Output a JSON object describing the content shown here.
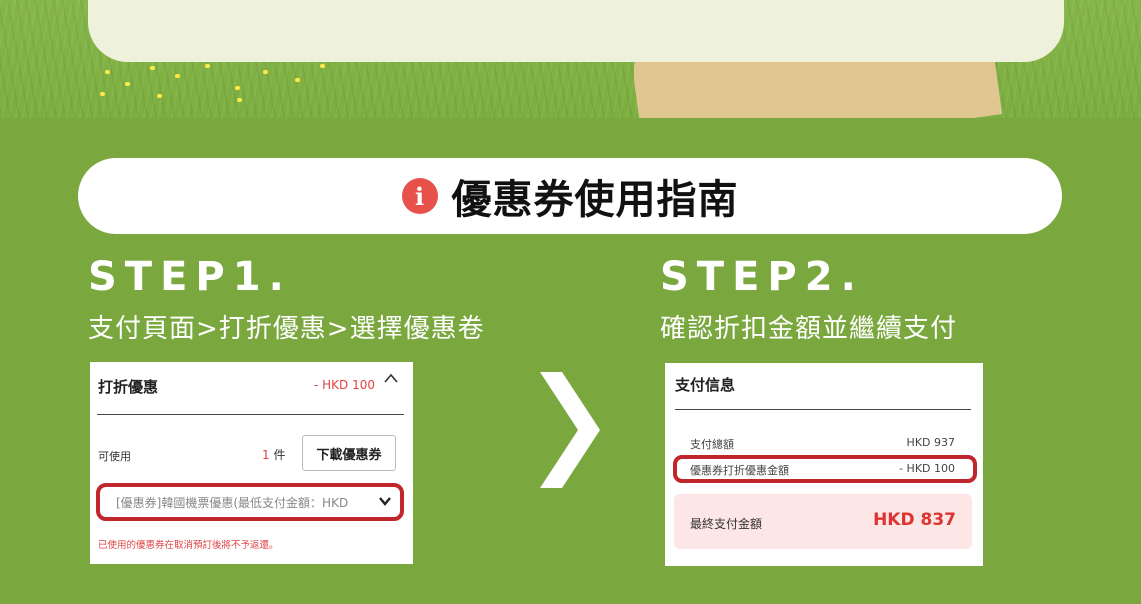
{
  "header": {
    "title": "優惠券使用指南",
    "info_icon": "info-icon"
  },
  "step1": {
    "title": "STEP1.",
    "subtitle": "支付頁面>打折優惠>選擇優惠卷",
    "panel": {
      "heading": "打折優惠",
      "amount": "- HKD 100",
      "available_label": "可使用",
      "count_number": "1",
      "count_unit": "件",
      "download_button": "下載優惠券",
      "select_value": "[優惠券]韓國機票優惠(最低支付金額：HKD",
      "warning": "已使用的優惠券在取消預訂後將不予返還。"
    }
  },
  "step2": {
    "title": "STEP2.",
    "subtitle": "確認折扣金額並繼續支付",
    "panel": {
      "heading": "支付信息",
      "total_label": "支付總額",
      "total_value": "HKD 937",
      "discount_label": "優惠券打折優惠金額",
      "discount_value": "- HKD 100",
      "final_label": "最終支付金額",
      "final_value": "HKD 837"
    }
  },
  "colors": {
    "background": "#7aa83e",
    "accent_red": "#c0262b",
    "info_red": "#e8504a"
  }
}
